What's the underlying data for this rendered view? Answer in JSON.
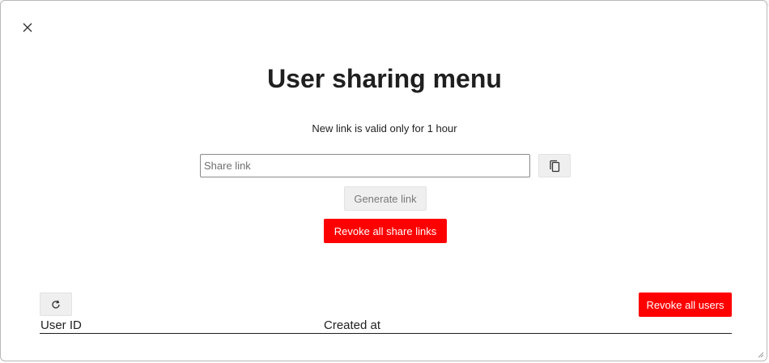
{
  "dialog": {
    "title": "User sharing menu",
    "subtitle": "New link is valid only for 1 hour",
    "close_icon": "close-icon"
  },
  "share": {
    "placeholder": "Share link",
    "value": "",
    "copy_icon": "copy-icon",
    "generate_label": "Generate link",
    "revoke_links_label": "Revoke all share links"
  },
  "users": {
    "refresh_icon": "refresh-icon",
    "revoke_users_label": "Revoke all users",
    "columns": [
      "User ID",
      "Created at"
    ],
    "rows": []
  },
  "colors": {
    "danger": "#ff0000",
    "neutral_button": "#efefef",
    "text": "#1f1f1f"
  }
}
